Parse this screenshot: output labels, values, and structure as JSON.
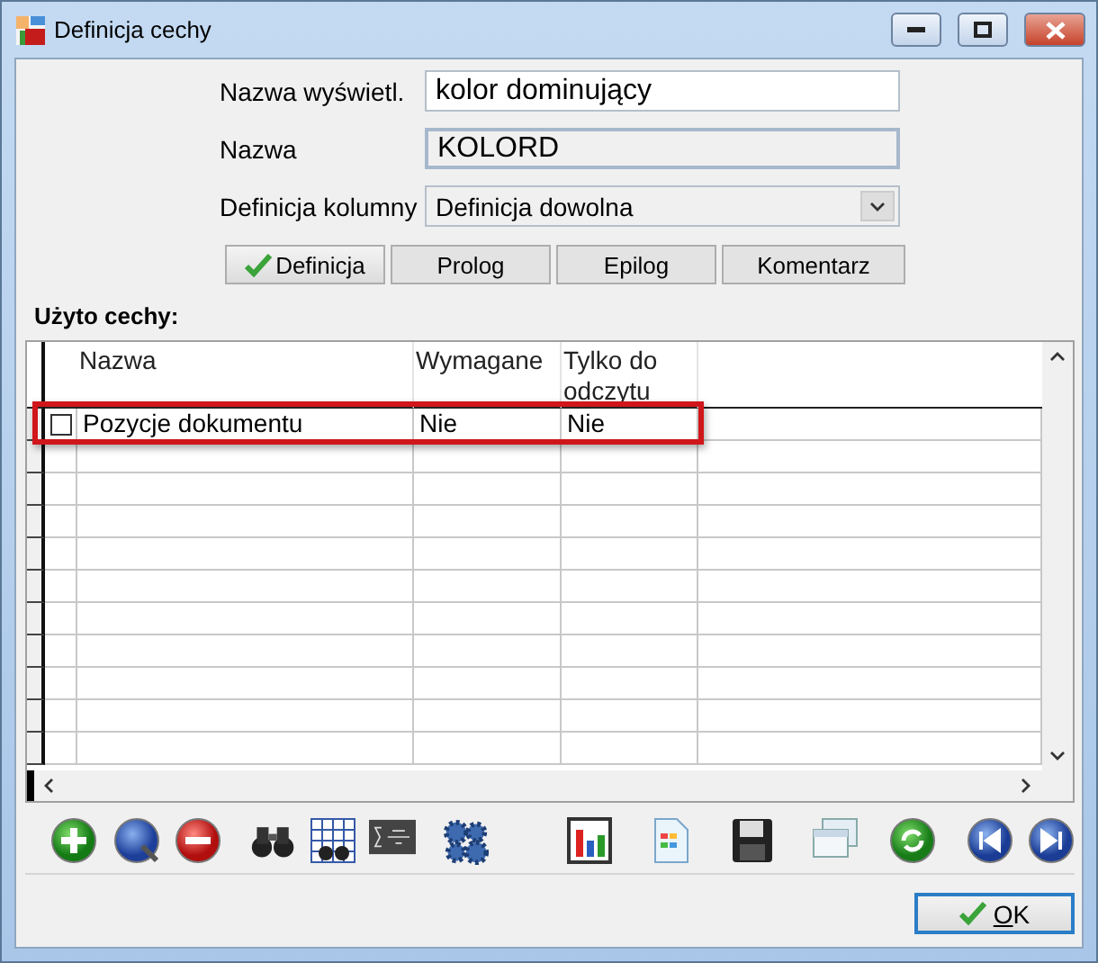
{
  "window": {
    "title": "Definicja cechy"
  },
  "fields": [
    {
      "label": "Nazwa wyświetl.",
      "kind": "text",
      "value": "kolor dominujący"
    },
    {
      "label": "Nazwa",
      "kind": "readonly",
      "value": "KOLORD"
    },
    {
      "label": "Definicja kolumny",
      "kind": "dropdown",
      "value": "Definicja dowolna",
      "disabled": true
    }
  ],
  "tabs": [
    {
      "label": "Definicja",
      "selected": true
    },
    {
      "label": "Prolog",
      "selected": false
    },
    {
      "label": "Epilog",
      "selected": false
    },
    {
      "label": "Komentarz",
      "selected": false
    }
  ],
  "section_label": "Użyto cechy:",
  "table": {
    "columns": [
      "Nazwa",
      "Wymagane",
      "Tylko do odczytu"
    ],
    "rows": [
      {
        "checked": false,
        "highlighted": true,
        "cells": [
          "Pozycje dokumentu",
          "Nie",
          "Nie"
        ]
      }
    ]
  },
  "ok_button": {
    "label": "OK"
  }
}
